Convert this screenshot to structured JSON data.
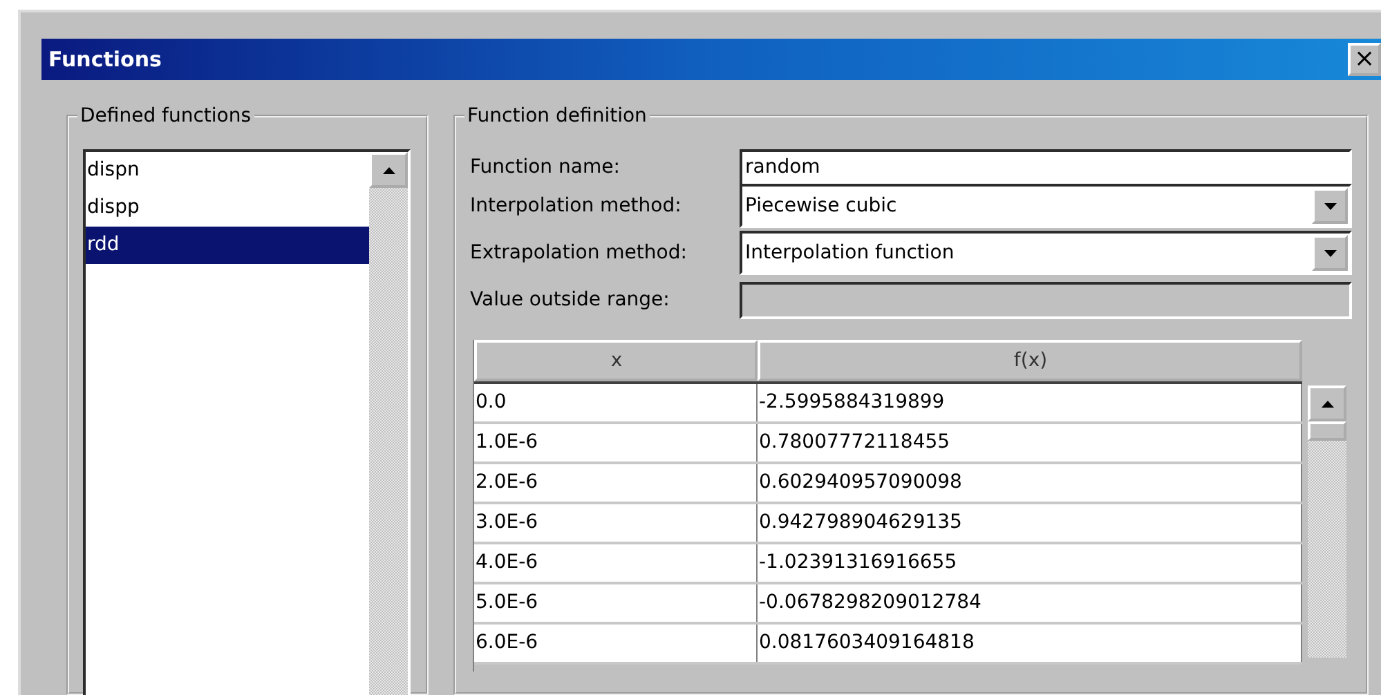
{
  "window": {
    "title": "Functions",
    "close": "×"
  },
  "defined_functions": {
    "title": "Defined functions",
    "items": [
      {
        "label": "dispn",
        "selected": false
      },
      {
        "label": "dispp",
        "selected": false
      },
      {
        "label": "rdd",
        "selected": true
      }
    ]
  },
  "function_definition": {
    "title": "Function definition",
    "fields": [
      {
        "kind": "text",
        "label": "Function name:",
        "value": "random",
        "disabled": false
      },
      {
        "kind": "combo",
        "label": "Interpolation method:",
        "value": "Piecewise cubic",
        "disabled": false
      },
      {
        "kind": "combo",
        "label": "Extrapolation method:",
        "value": "Interpolation function",
        "disabled": false
      },
      {
        "kind": "text",
        "label": "Value outside range:",
        "disabled": true
      }
    ],
    "table": {
      "columns": [
        "x",
        "f(x)"
      ],
      "rows": [
        [
          "0.0",
          "-2.5995884319899"
        ],
        [
          "1.0E-6",
          "0.78007772118455"
        ],
        [
          "2.0E-6",
          "0.602940957090098"
        ],
        [
          "3.0E-6",
          "0.942798904629135"
        ],
        [
          "4.0E-6",
          "-1.02391316916655"
        ],
        [
          "5.0E-6",
          "-0.0678298209012784"
        ],
        [
          "6.0E-6",
          "0.0817603409164818"
        ]
      ]
    }
  }
}
